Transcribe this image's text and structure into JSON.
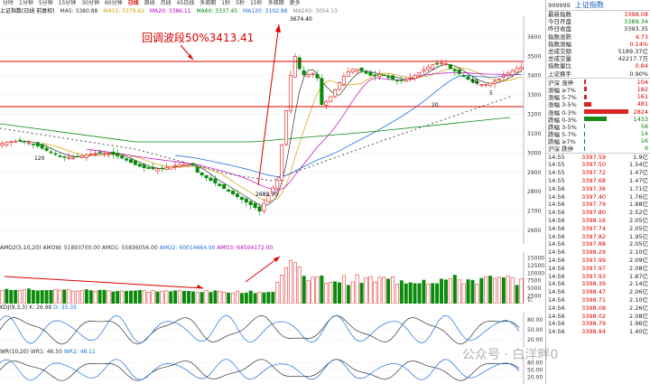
{
  "toolbar": {
    "items": [
      "分时",
      "1分钟",
      "5分钟",
      "15分钟",
      "30分钟",
      "60分钟",
      "日线",
      "周线",
      "月线",
      "45日线",
      "多周期",
      "1秒",
      "5秒",
      "15秒",
      "多周期",
      "更多"
    ],
    "active_index": 6
  },
  "ma_legend": {
    "index_name": "上证指数(日线 前复权)",
    "ma5": "MA5: 3380.88",
    "ma10": "MA10: 3379.62",
    "ma20": "MA20: 3386.11",
    "ma60": "MA60: 3337.45",
    "ma120": "MA120: 3102.88",
    "ma240": "MA240: 3054.13"
  },
  "annotation": {
    "text": "回调波段50%3413.41",
    "high": "3674.40",
    "low": "2689.70",
    "label_120": "120",
    "label_20": "20",
    "label_10": "10",
    "label_5": "5"
  },
  "price_axis": [
    "3600",
    "3500",
    "3400",
    "3300",
    "3200",
    "3100",
    "3000",
    "2900",
    "2800",
    "2700",
    "2600"
  ],
  "vol_head": {
    "name": "AMO2(5,10,20)",
    "amow": "AMOW: 51893700.00",
    "amo1": "AMO1: 55836056.00",
    "amo2": "AMO2: 60014664.00",
    "amo3": "AMO3: 64504172.00"
  },
  "vol_axis": [
    "15000",
    "12500",
    "10000",
    "7500",
    "5000",
    "2500"
  ],
  "vol_unit": "亿",
  "kdj_head": {
    "name": "KDJ(9,3,3)",
    "k": "K: 26.98",
    "d": "D: 35.35"
  },
  "kdj_axis": [
    "80.00",
    "50.00",
    "20.00"
  ],
  "wr_head": {
    "name": "WR(10,20)",
    "wr1": "WR1: 46.50",
    "wr2": "WR2: 48.11"
  },
  "wr_axis": [
    "80.00",
    "50.00",
    "20.00"
  ],
  "side": {
    "code": "999999",
    "name": "上证指数",
    "stats": [
      {
        "k": "最新指数",
        "v": "3398.08",
        "c": "r"
      },
      {
        "k": "今日开盘",
        "v": "3389.34",
        "c": "g"
      },
      {
        "k": "昨日收盘",
        "v": "3393.35",
        "c": "b"
      },
      {
        "k": "指数涨跌",
        "v": "4.73",
        "c": "r"
      },
      {
        "k": "指数涨幅",
        "v": "0.14%",
        "c": "r"
      },
      {
        "k": "总成交额",
        "v": "5189.37亿",
        "c": "b"
      },
      {
        "k": "总成交量",
        "v": "42217.7万",
        "c": "b"
      },
      {
        "k": "指数量比",
        "v": "0.84",
        "c": "r"
      },
      {
        "k": "上证换手",
        "v": "0.90%",
        "c": "b"
      }
    ],
    "breadth": [
      {
        "k": "沪深 涨停",
        "v": "104",
        "dir": "up",
        "w": 0.04
      },
      {
        "k": "涨幅 ≥7%",
        "v": "182",
        "dir": "up",
        "w": 0.07
      },
      {
        "k": "涨幅 5-7%",
        "v": "161",
        "dir": "up",
        "w": 0.06
      },
      {
        "k": "涨幅 3-5%",
        "v": "481",
        "dir": "up",
        "w": 0.17
      },
      {
        "k": "涨幅 0-3%",
        "v": "2824",
        "dir": "up",
        "w": 1.0
      },
      {
        "k": "跌幅 0-3%",
        "v": "1433",
        "dir": "dn",
        "w": 0.5
      },
      {
        "k": "跌幅 3-5%",
        "v": "58",
        "dir": "dn",
        "w": 0.02
      },
      {
        "k": "跌幅 5-7%",
        "v": "14",
        "dir": "dn",
        "w": 0.01
      },
      {
        "k": "跌幅 ≥7%",
        "v": "16",
        "dir": "dn",
        "w": 0.01
      },
      {
        "k": "沪深 跌停",
        "v": "9",
        "dir": "dn",
        "w": 0.005
      }
    ],
    "ticks": [
      {
        "t": "14:55",
        "p": "3397.59",
        "v": "1.9亿"
      },
      {
        "t": "14:55",
        "p": "3397.50",
        "v": "1.54亿"
      },
      {
        "t": "14:55",
        "p": "3397.72",
        "v": "1.47亿"
      },
      {
        "t": "14:55",
        "p": "3397.68",
        "v": "1.47亿"
      },
      {
        "t": "14:56",
        "p": "3397.36",
        "v": "1.71亿"
      },
      {
        "t": "14:56",
        "p": "3397.40",
        "v": "1.76亿"
      },
      {
        "t": "14:56",
        "p": "3397.79",
        "v": "1.88亿"
      },
      {
        "t": "14:56",
        "p": "3397.80",
        "v": "2.52亿"
      },
      {
        "t": "14:56",
        "p": "3398.16",
        "v": "2.05亿"
      },
      {
        "t": "14:56",
        "p": "3397.74",
        "v": "2.05亿"
      },
      {
        "t": "14:56",
        "p": "3397.82",
        "v": "1.95亿"
      },
      {
        "t": "14:56",
        "p": "3397.88",
        "v": "2.05亿"
      },
      {
        "t": "14:56",
        "p": "3398.29",
        "v": "2.10亿"
      },
      {
        "t": "14:56",
        "p": "3397.99",
        "v": "2.09亿"
      },
      {
        "t": "14:56",
        "p": "3397.97",
        "v": "2.08亿"
      },
      {
        "t": "14:56",
        "p": "3397.93",
        "v": "1.87亿"
      },
      {
        "t": "14:56",
        "p": "3398.39",
        "v": "2.14亿"
      },
      {
        "t": "14:56",
        "p": "3398.47",
        "v": "2.06亿"
      },
      {
        "t": "14:56",
        "p": "3398.71",
        "v": "2.10亿"
      },
      {
        "t": "14:56",
        "p": "3398.08",
        "v": "2.26亿"
      },
      {
        "t": "14:56",
        "p": "3398.02",
        "v": "2.08亿"
      },
      {
        "t": "14:56",
        "p": "3398.79",
        "v": "1.96亿"
      },
      {
        "t": "14:56",
        "p": "3398.94",
        "v": "1.40亿"
      }
    ]
  },
  "watermark": "公众号 · 白洋畔0"
}
